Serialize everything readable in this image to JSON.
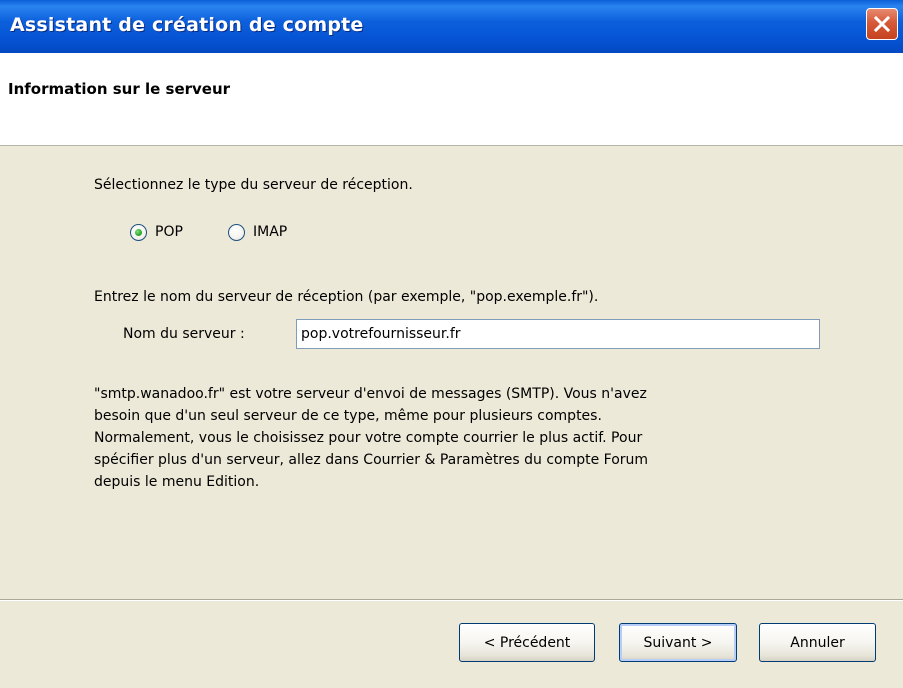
{
  "window": {
    "title": "Assistant de création de compte",
    "close_label": "Fermer"
  },
  "header": {
    "title": "Information sur le serveur"
  },
  "server_type": {
    "prompt": "Sélectionnez le type du serveur de réception.",
    "options": [
      {
        "label": "POP",
        "selected": true
      },
      {
        "label": "IMAP",
        "selected": false
      }
    ]
  },
  "server_name": {
    "prompt": "Entrez le nom du serveur de réception (par exemple, \"pop.exemple.fr\").",
    "label": "Nom du serveur :",
    "value": "pop.votrefournisseur.fr"
  },
  "info_text": "\"smtp.wanadoo.fr\" est votre serveur d'envoi de messages (SMTP). Vous n'avez\nbesoin que d'un seul serveur de ce type, même pour plusieurs comptes.\nNormalement, vous le choisissez pour votre compte courrier le plus actif. Pour\nspécifier plus d'un serveur, allez dans Courrier & Paramètres du compte Forum\ndepuis le menu Edition.",
  "buttons": {
    "back": "< Précédent",
    "next": "Suivant >",
    "cancel": "Annuler"
  },
  "colors": {
    "titlebar": "#0655d6",
    "body_background": "#ece9d8",
    "header_background": "#ffffff",
    "close_button": "#d65a39",
    "radio_selected": "#21a121"
  }
}
